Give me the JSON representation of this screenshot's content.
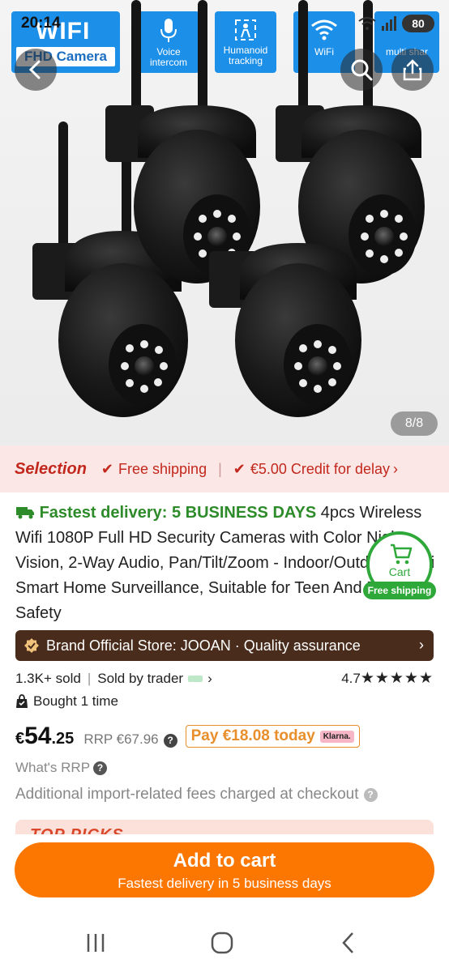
{
  "status_bar": {
    "time": "20:14",
    "battery": "80"
  },
  "hero": {
    "tiles": {
      "wifi_word": "WIFI",
      "camera_label": "FHD Camera",
      "voice": "Voice intercom",
      "humanoid": "Humanoid tracking",
      "wifi": "WiFi",
      "multi": "multi shar"
    },
    "page_indicator": "8/8"
  },
  "selection_bar": {
    "title": "Selection",
    "free_shipping": "Free shipping",
    "credit": "€5.00 Credit for delay"
  },
  "product": {
    "fast_tag": "Fastest delivery: 5 BUSINESS DAYS",
    "title": " 4pcs Wireless Wifi 1080P Full HD Security Cameras with Color Night Vision, 2-Way Audio, Pan/Tilt/Zoom - Indoor/Outdoor Wi-Fi Smart Home Surveillance, Suitable for Teen And Pet Safety"
  },
  "floating_cart": {
    "label": "Cart",
    "pill": "Free shipping"
  },
  "brand_bar": {
    "text": "Brand Official Store: JOOAN · Quality assurance"
  },
  "meta": {
    "sold": "1.3K+ sold",
    "sold_by": "Sold by trader",
    "rating": "4.7",
    "stars": "★★★★★",
    "bought": "Bought 1 time"
  },
  "price": {
    "currency": "€",
    "integer": "54",
    "decimal": ".25",
    "rrp": "RRP €67.96",
    "pay_today": "Pay €18.08 today",
    "klarna": "Klarna."
  },
  "whats_rrp": "What's RRP",
  "fees_note": "Additional import-related fees charged at checkout",
  "top_picks": "TOP PICKS",
  "add_to_cart": {
    "main": "Add to cart",
    "sub": "Fastest delivery in 5 business days"
  },
  "colors": {
    "accent": "#fb7701",
    "selection_red": "#c2281d",
    "green": "#2e8b2a",
    "brand_bar": "#4a2c1c"
  }
}
